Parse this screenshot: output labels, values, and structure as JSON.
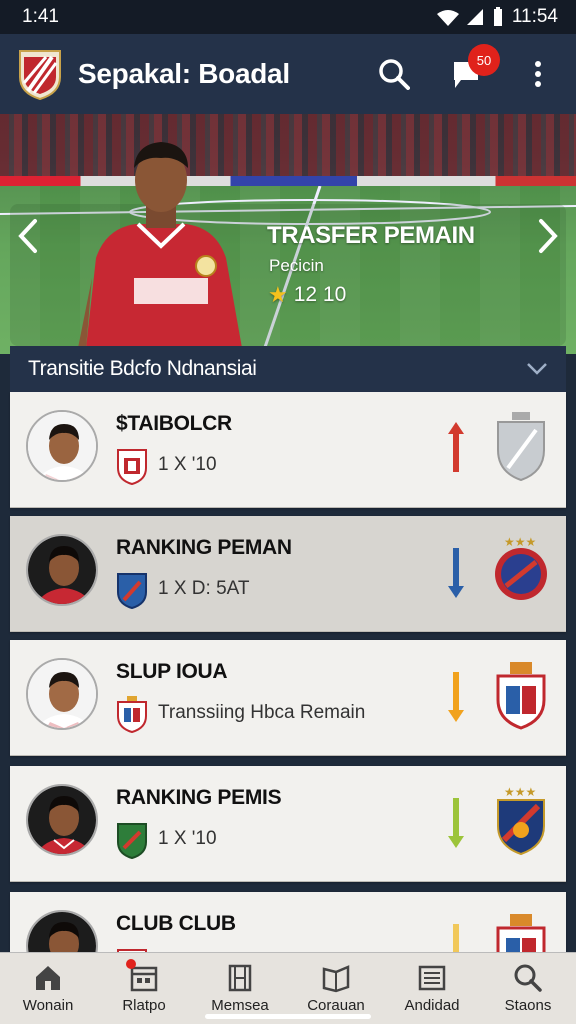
{
  "status_bar": {
    "time": "1:41",
    "clock": "11:54"
  },
  "app": {
    "title": "Sepakal: Boadal",
    "notification_count": "50"
  },
  "hero": {
    "title": "TRASFER PEMAIN",
    "subtitle": "Pecicin",
    "rating": "12 10"
  },
  "section": {
    "title": "Transitie Bdcfo Ndnansiai"
  },
  "list": [
    {
      "title": "$TAIBOLCR",
      "meta": "1 X '10",
      "trend_color": "#d23a2e",
      "badge_color": "#c0282e"
    },
    {
      "title": "RANKING PEMAN",
      "meta": "1 X D: 5AT",
      "trend_color": "#2a5fa8",
      "badge_color": "#2a5fa8"
    },
    {
      "title": "SLUP IOUA",
      "meta": "Transsiing Hbca Remain",
      "trend_color": "#f1a21d",
      "badge_color": "#c0282e"
    },
    {
      "title": "RANKING PEMIS",
      "meta": "1 X '10",
      "trend_color": "#9cc43a",
      "badge_color": "#2e7d3a"
    },
    {
      "title": "CLUB CLUB",
      "meta": "",
      "trend_color": "#f1c85a",
      "badge_color": "#c0282e"
    }
  ],
  "nav": [
    {
      "label": "Wonain",
      "icon": "home-icon"
    },
    {
      "label": "Rlatpo",
      "icon": "calendar-icon"
    },
    {
      "label": "Memsea",
      "icon": "film-icon"
    },
    {
      "label": "Corauan",
      "icon": "book-icon"
    },
    {
      "label": "Andidad",
      "icon": "list-icon"
    },
    {
      "label": "Staons",
      "icon": "search-icon"
    }
  ],
  "colors": {
    "primary": "#243249",
    "accent": "#e0221b",
    "star": "#f4c21c"
  }
}
